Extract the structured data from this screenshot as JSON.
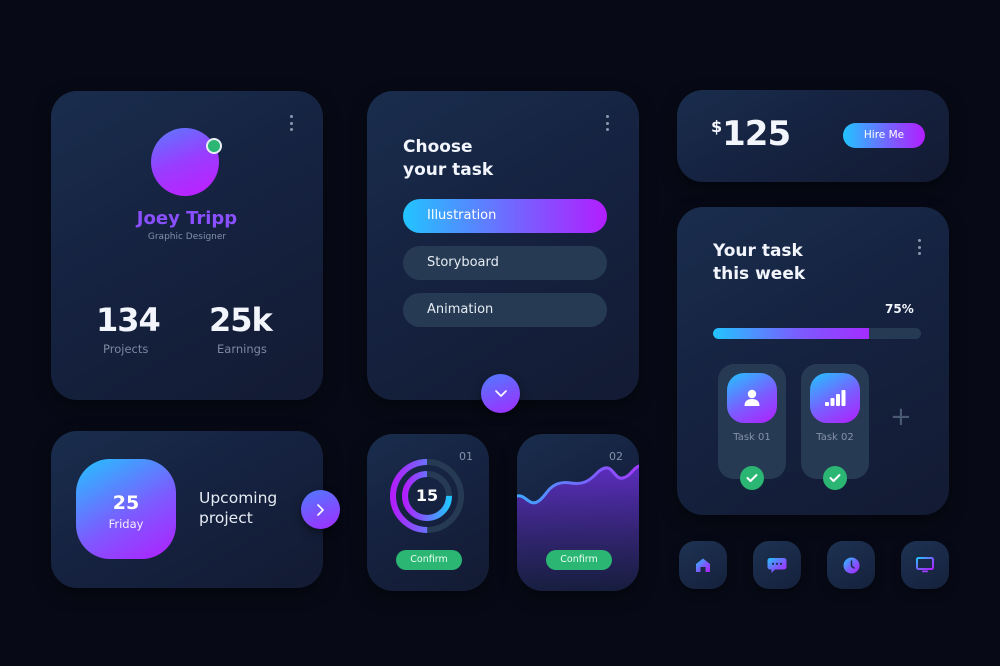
{
  "profile": {
    "name": "Joey Tripp",
    "role": "Graphic Designer",
    "status": "online",
    "stats": [
      {
        "value": "134",
        "label": "Projects"
      },
      {
        "value": "25k",
        "label": "Earnings"
      }
    ],
    "menu_icon": "kebab-icon"
  },
  "choose_task": {
    "title_line1": "Choose",
    "title_line2": "your task",
    "options": [
      {
        "label": "Illustration",
        "selected": true
      },
      {
        "label": "Storyboard",
        "selected": false
      },
      {
        "label": "Animation",
        "selected": false
      }
    ],
    "expand_icon": "chevron-down-icon"
  },
  "price": {
    "currency": "$",
    "amount": "125",
    "button_label": "Hire Me"
  },
  "weekly": {
    "title_line1": "Your task",
    "title_line2": "this week",
    "progress_label": "75%",
    "progress": 0.75,
    "tasks": [
      {
        "label": "Task 01",
        "icon": "user-icon",
        "done": true
      },
      {
        "label": "Task 02",
        "icon": "signal-bars-icon",
        "done": true
      }
    ],
    "add_icon": "plus-icon"
  },
  "upcoming": {
    "day_number": "25",
    "weekday": "Friday",
    "title_line1": "Upcoming",
    "title_line2": "project",
    "next_icon": "chevron-right-icon"
  },
  "widgets": [
    {
      "index": "01",
      "value": "15",
      "outer_ring": 0.5,
      "inner_ring": 0.75,
      "button_label": "Confirm"
    },
    {
      "index": "02",
      "button_label": "Confirm"
    }
  ],
  "nav": [
    {
      "icon": "home-icon"
    },
    {
      "icon": "chat-icon"
    },
    {
      "icon": "clock-icon"
    },
    {
      "icon": "monitor-icon"
    }
  ],
  "colors": {
    "background": "#070a16",
    "card": "#152240",
    "accent_start": "#22c4ff",
    "accent_end": "#b21eff",
    "success": "#2bb673",
    "pill": "#263b53"
  }
}
